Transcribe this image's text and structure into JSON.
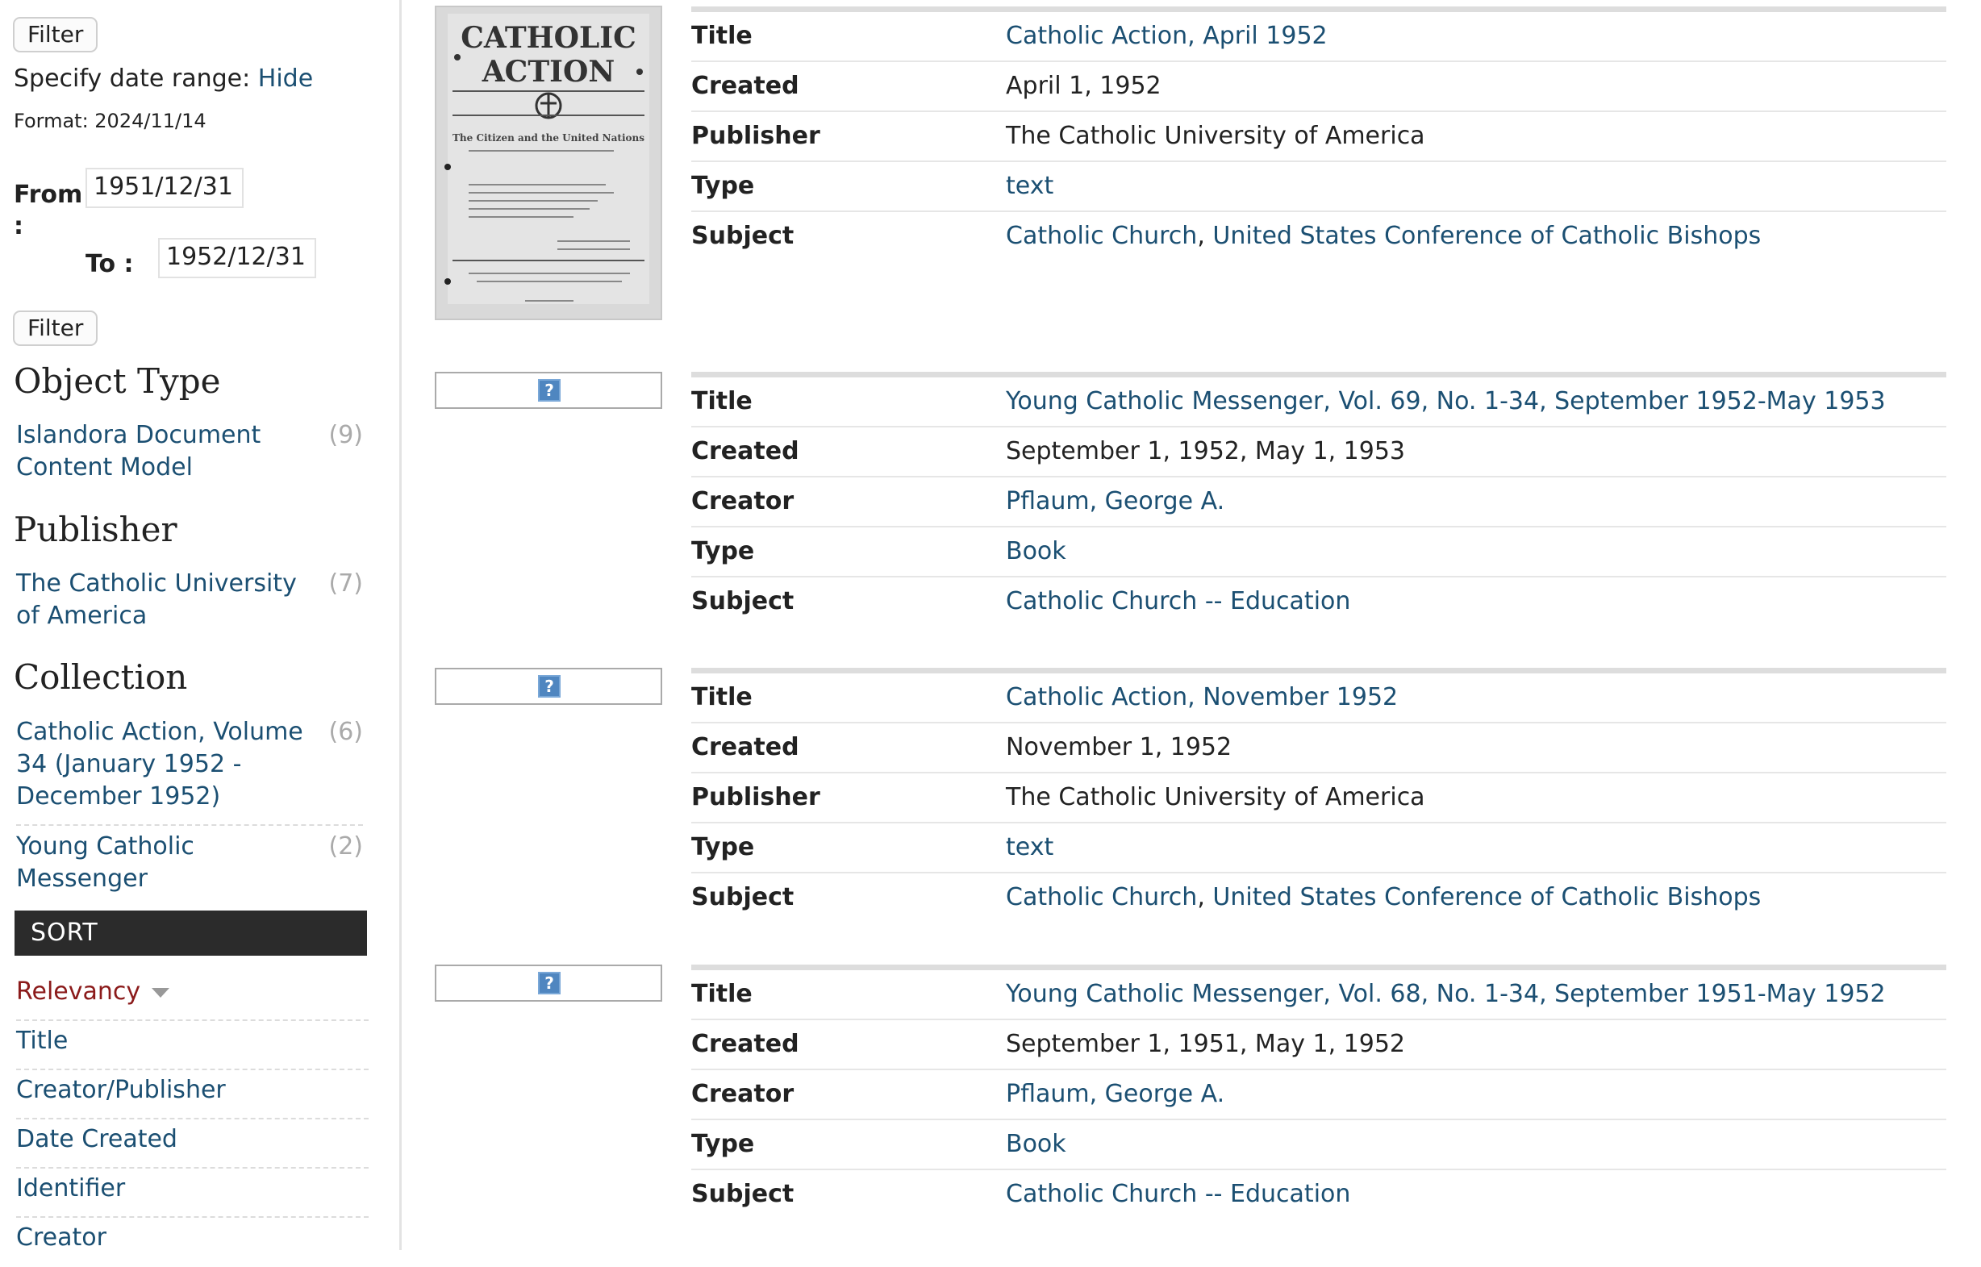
{
  "sidebar": {
    "filter_button_label": "Filter",
    "date_range_label": "Specify date range:",
    "date_range_toggle": "Hide",
    "date_format_hint": "Format: 2024/11/14",
    "from_label": "From",
    "from_colon": ":",
    "from_value": "1951/12/31",
    "to_label": "To :",
    "to_value": "1952/12/31",
    "facets": [
      {
        "heading": "Object Type",
        "items": [
          {
            "label": "Islandora Document Content Model",
            "count": "(9)"
          }
        ]
      },
      {
        "heading": "Publisher",
        "items": [
          {
            "label": "The Catholic University of America",
            "count": "(7)"
          }
        ]
      },
      {
        "heading": "Collection",
        "items": [
          {
            "label": "Catholic Action, Volume 34 (January 1952 - December 1952)",
            "count": "(6)"
          },
          {
            "label": "Young Catholic Messenger",
            "count": "(2)"
          }
        ]
      }
    ],
    "sort": {
      "header": "SORT",
      "items": [
        "Relevancy",
        "Title",
        "Creator/Publisher",
        "Date Created",
        "Identifier",
        "Creator"
      ]
    }
  },
  "thumbnail_cover": {
    "title_line1": "CATHOLIC",
    "title_line2": "ACTION",
    "subtitle": "The Citizen and the United Nations"
  },
  "placeholder_icon": "?",
  "results": [
    {
      "fields": [
        {
          "key": "Title",
          "value": "Catholic Action, April 1952",
          "link": true
        },
        {
          "key": "Created",
          "value": "April 1, 1952",
          "link": false
        },
        {
          "key": "Publisher",
          "value": "The Catholic University of America",
          "link": false
        },
        {
          "key": "Type",
          "value": "text",
          "link": true
        },
        {
          "key": "Subject",
          "subjects": [
            "Catholic Church",
            "United States Conference of Catholic Bishops"
          ]
        }
      ]
    },
    {
      "fields": [
        {
          "key": "Title",
          "value": "Young Catholic Messenger, Vol. 69, No. 1-34, September 1952-May 1953",
          "link": true
        },
        {
          "key": "Created",
          "value": "September 1, 1952, May 1, 1953",
          "link": false
        },
        {
          "key": "Creator",
          "value": "Pflaum, George A.",
          "link": true
        },
        {
          "key": "Type",
          "value": "Book",
          "link": true
        },
        {
          "key": "Subject",
          "subjects": [
            "Catholic Church -- Education"
          ]
        }
      ]
    },
    {
      "fields": [
        {
          "key": "Title",
          "value": "Catholic Action, November 1952",
          "link": true
        },
        {
          "key": "Created",
          "value": "November 1, 1952",
          "link": false
        },
        {
          "key": "Publisher",
          "value": "The Catholic University of America",
          "link": false
        },
        {
          "key": "Type",
          "value": "text",
          "link": true
        },
        {
          "key": "Subject",
          "subjects": [
            "Catholic Church",
            "United States Conference of Catholic Bishops"
          ]
        }
      ]
    },
    {
      "fields": [
        {
          "key": "Title",
          "value": "Young Catholic Messenger, Vol. 68, No. 1-34, September 1951-May 1952",
          "link": true
        },
        {
          "key": "Created",
          "value": "September 1, 1951, May 1, 1952",
          "link": false
        },
        {
          "key": "Creator",
          "value": "Pflaum, George A.",
          "link": true
        },
        {
          "key": "Type",
          "value": "Book",
          "link": true
        },
        {
          "key": "Subject",
          "subjects": [
            "Catholic Church -- Education"
          ]
        }
      ]
    }
  ]
}
